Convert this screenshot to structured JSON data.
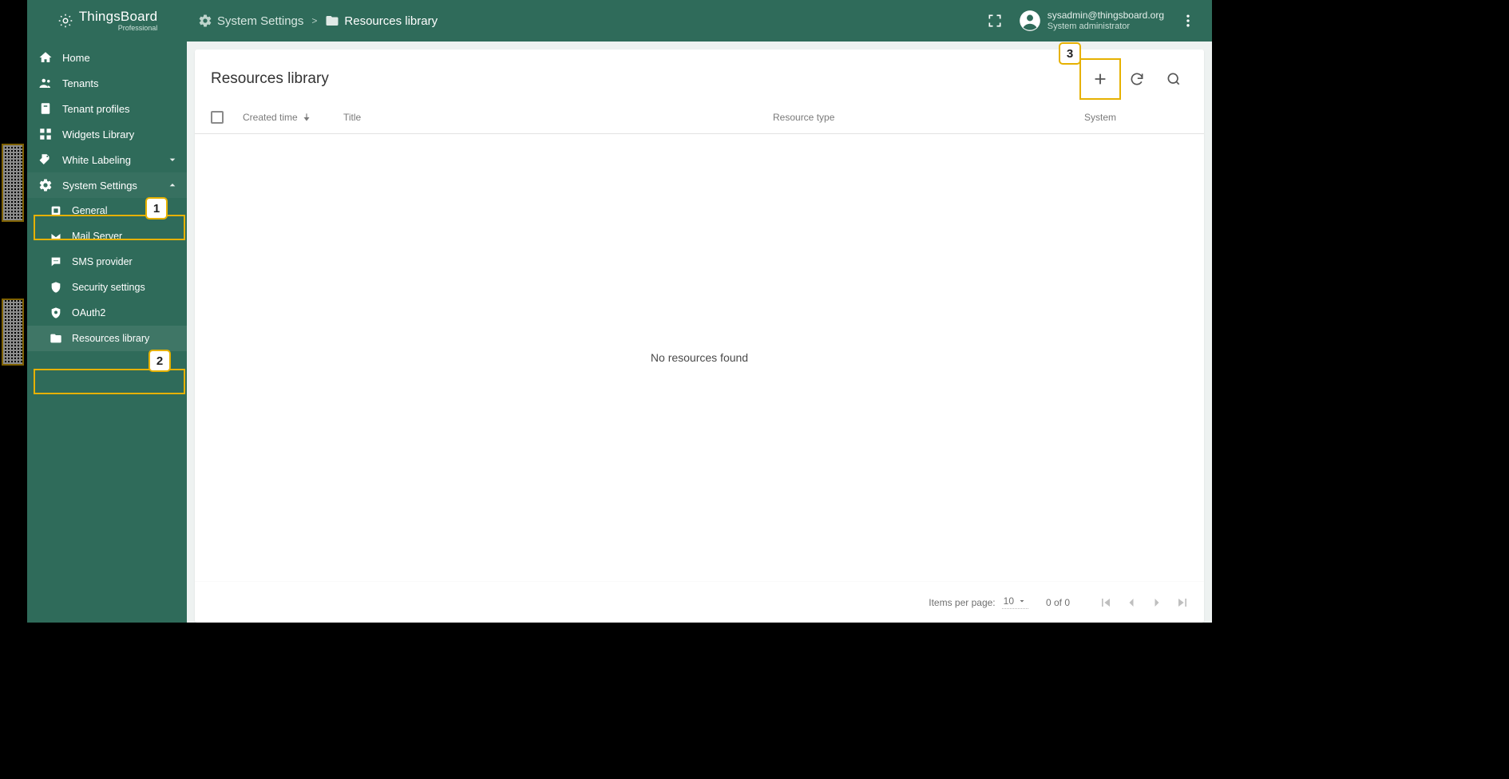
{
  "brand": {
    "name": "ThingsBoard",
    "edition": "Professional"
  },
  "breadcrumb": {
    "items": [
      {
        "icon": "settings",
        "label": "System Settings"
      },
      {
        "icon": "folder",
        "label": "Resources library"
      }
    ],
    "separator": ">"
  },
  "user": {
    "email": "sysadmin@thingsboard.org",
    "role": "System administrator"
  },
  "sidebar": {
    "home": "Home",
    "tenants": "Tenants",
    "tenant_profiles": "Tenant profiles",
    "widgets_library": "Widgets Library",
    "white_labeling": "White Labeling",
    "system_settings": "System Settings",
    "submenu": {
      "general": "General",
      "mail_server": "Mail Server",
      "sms_provider": "SMS provider",
      "security_settings": "Security settings",
      "oauth2": "OAuth2",
      "resources_library": "Resources library"
    }
  },
  "callouts": {
    "one": "1",
    "two": "2",
    "three": "3"
  },
  "page": {
    "title": "Resources library",
    "columns": {
      "created_time": "Created time",
      "title": "Title",
      "resource_type": "Resource type",
      "system": "System"
    },
    "empty": "No resources found"
  },
  "paginator": {
    "items_per_page_label": "Items per page:",
    "page_size": "10",
    "range": "0 of 0"
  }
}
